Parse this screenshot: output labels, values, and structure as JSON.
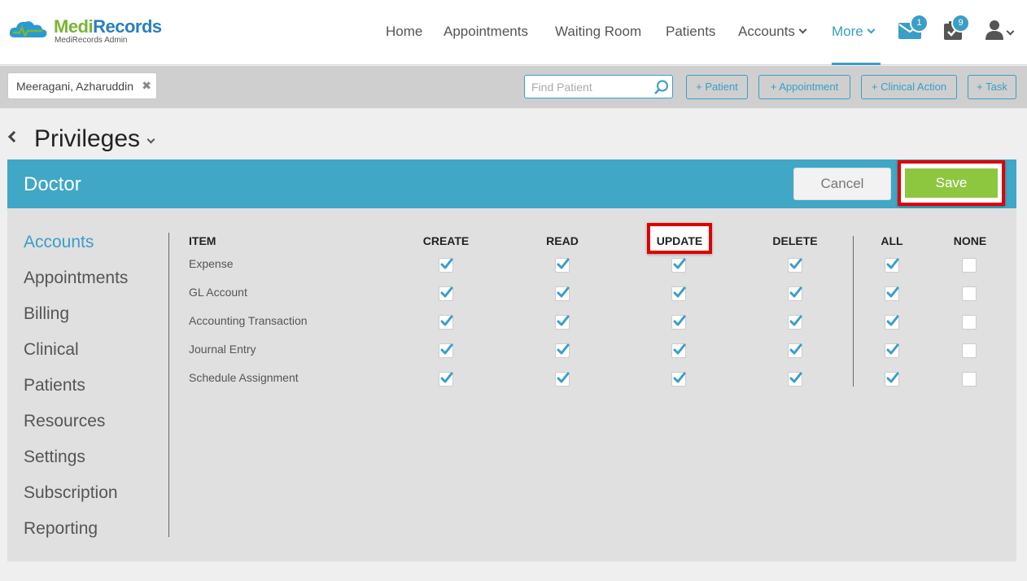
{
  "brand": {
    "name_part1": "Medi",
    "name_part2": "Records",
    "subtitle": "MediRecords Admin"
  },
  "nav": {
    "items": [
      {
        "label": "Home"
      },
      {
        "label": "Appointments"
      },
      {
        "label": "Waiting Room"
      },
      {
        "label": "Patients"
      },
      {
        "label": "Accounts"
      },
      {
        "label": "More"
      }
    ],
    "active": "More",
    "mail_badge": "1",
    "tasks_badge": "9",
    "icons": [
      "mail-icon",
      "tasks-icon",
      "user-icon"
    ]
  },
  "subbar": {
    "patient_chip": "Meeragani, Azharuddin",
    "search_placeholder": "Find Patient",
    "buttons": [
      "+ Patient",
      "+ Appointment",
      "+ Clinical Action",
      "+ Task"
    ]
  },
  "page": {
    "title": "Privileges"
  },
  "role": {
    "name": "Doctor",
    "cancel_label": "Cancel",
    "save_label": "Save"
  },
  "sidebar": {
    "items": [
      "Accounts",
      "Appointments",
      "Billing",
      "Clinical",
      "Patients",
      "Resources",
      "Settings",
      "Subscription",
      "Reporting"
    ],
    "active": "Accounts"
  },
  "table": {
    "headers": [
      "ITEM",
      "CREATE",
      "READ",
      "UPDATE",
      "DELETE",
      "ALL",
      "NONE"
    ],
    "rows": [
      {
        "item": "Expense",
        "create": true,
        "read": true,
        "update": true,
        "delete": true,
        "all": true,
        "none": false
      },
      {
        "item": "GL Account",
        "create": true,
        "read": true,
        "update": true,
        "delete": true,
        "all": true,
        "none": false
      },
      {
        "item": "Accounting Transaction",
        "create": true,
        "read": true,
        "update": true,
        "delete": true,
        "all": true,
        "none": false
      },
      {
        "item": "Journal Entry",
        "create": true,
        "read": true,
        "update": true,
        "delete": true,
        "all": true,
        "none": false
      },
      {
        "item": "Schedule Assignment",
        "create": true,
        "read": true,
        "update": true,
        "delete": true,
        "all": true,
        "none": false
      }
    ]
  },
  "colors": {
    "accent": "#40a7c7",
    "save_green": "#8dc63f",
    "highlight_red": "#e00000"
  }
}
